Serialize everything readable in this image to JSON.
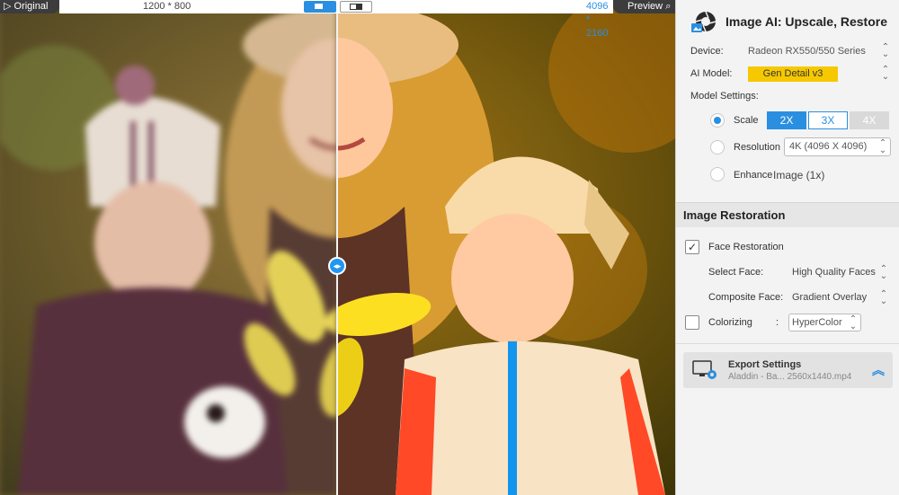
{
  "viewer": {
    "original_label": "Original",
    "left_resolution": "1200 * 800",
    "right_resolution": "4096 * 2160",
    "preview_label": "Preview"
  },
  "panel": {
    "app_title": "Image AI: Upscale, Restore",
    "device_label": "Device:",
    "device_value": "Radeon RX550/550 Series",
    "ai_model_label": "AI Model:",
    "ai_model_value": "Gen Detail v3",
    "model_settings_label": "Model Settings:",
    "scale_label": "Scale",
    "scale_options": [
      "2X",
      "3X",
      "4X"
    ],
    "resolution_label": "Resolution",
    "resolution_value": "4K (4096 X 4096)",
    "enhance_label": "Enhance",
    "enhance_value": "Image (1x)",
    "image_restoration_title": "Image Restoration",
    "face_restoration_label": "Face Restoration",
    "select_face_label": "Select Face:",
    "select_face_value": "High Quality Faces",
    "composite_face_label": "Composite Face:",
    "composite_face_value": "Gradient Overlay",
    "colorizing_label": "Colorizing",
    "colorizing_colon": ":",
    "colorizing_value": "HyperColor",
    "export_title": "Export Settings",
    "export_sub": "Aladdin - Ba... 2560x1440.mp4"
  },
  "colors": {
    "accent": "#2a8fe0",
    "model_badge": "#f6c800"
  }
}
